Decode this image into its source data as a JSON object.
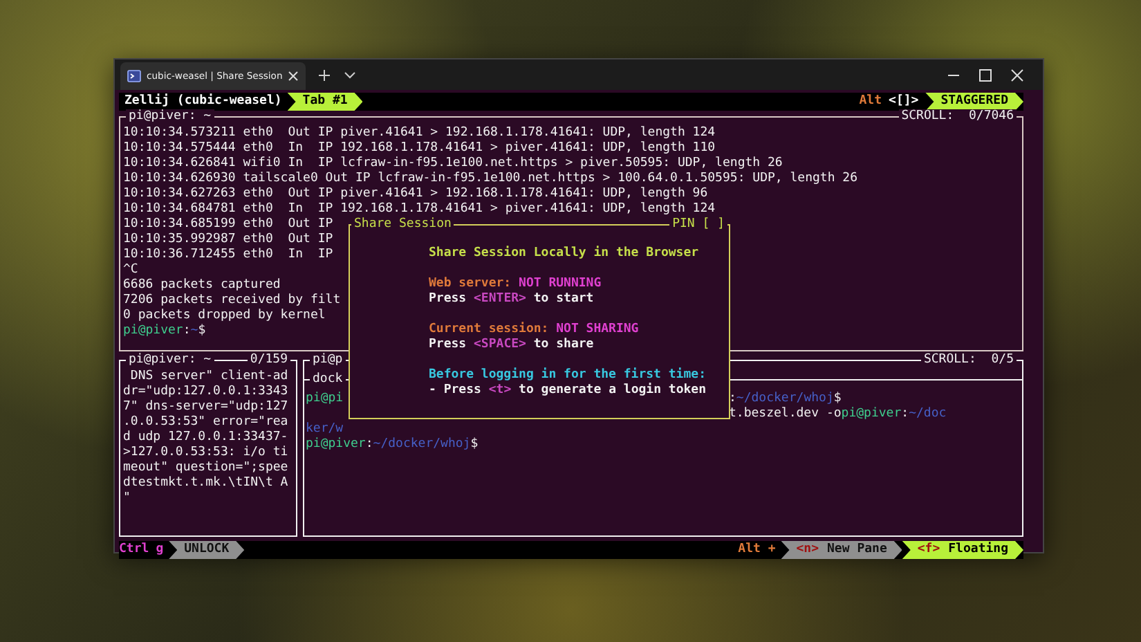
{
  "window": {
    "tab_title": "cubic-weasel | Share Session"
  },
  "top_bar": {
    "session": "Zellij (cubic-weasel)",
    "tabs": [
      {
        "label": "Tab #1",
        "selected": true
      }
    ],
    "modifier": "Alt",
    "key": "<[]>",
    "layout": "STAGGERED"
  },
  "top_pane": {
    "title": "pi@piver: ~",
    "scroll": "SCROLL:  0/7046",
    "lines": [
      {
        "segments": [
          {
            "text": "10:10:34.573211 eth0  Out IP piver.41641 > 192.168.1.178.41641: UDP, length 124",
            "kind": "plain"
          }
        ]
      },
      {
        "segments": [
          {
            "text": "10:10:34.575444 eth0  In  IP 192.168.1.178.41641 > piver.41641: UDP, length 110",
            "kind": "plain"
          }
        ]
      },
      {
        "segments": [
          {
            "text": "10:10:34.626841 wifi0 In  IP lcfraw-in-f95.1e100.net.https > piver.50595: UDP, length 26",
            "kind": "plain"
          }
        ]
      },
      {
        "segments": [
          {
            "text": "10:10:34.626930 tailscale0 Out IP lcfraw-in-f95.1e100.net.https > 100.64.0.1.50595: UDP, length 26",
            "kind": "plain"
          }
        ]
      },
      {
        "segments": [
          {
            "text": "10:10:34.627263 eth0  Out IP piver.41641 > 192.168.1.178.41641: UDP, length 96",
            "kind": "plain"
          }
        ]
      },
      {
        "segments": [
          {
            "text": "10:10:34.684781 eth0  In  IP 192.168.1.178.41641 > piver.41641: UDP, length 124",
            "kind": "plain"
          }
        ]
      },
      {
        "segments": [
          {
            "text": "10:10:34.685199 eth0  Out IP",
            "kind": "plain"
          }
        ]
      },
      {
        "segments": [
          {
            "text": "10:10:35.992987 eth0  Out IP",
            "kind": "plain"
          }
        ]
      },
      {
        "segments": [
          {
            "text": "10:10:36.712455 eth0  In  IP",
            "kind": "plain"
          }
        ]
      },
      {
        "segments": [
          {
            "text": "^C",
            "kind": "plain"
          }
        ]
      },
      {
        "segments": [
          {
            "text": "6686 packets captured",
            "kind": "plain"
          }
        ]
      },
      {
        "segments": [
          {
            "text": "7206 packets received by filt",
            "kind": "plain"
          }
        ]
      },
      {
        "segments": [
          {
            "text": "0 packets dropped by kernel",
            "kind": "plain"
          }
        ]
      },
      {
        "segments": [
          {
            "text": "pi@piver",
            "kind": "user"
          },
          {
            "text": ":",
            "kind": "plain"
          },
          {
            "text": "~",
            "kind": "path"
          },
          {
            "text": "$",
            "kind": "plain"
          }
        ]
      }
    ]
  },
  "bottom_left_pane": {
    "title": "pi@piver: ~",
    "position": "0/159",
    "lines": [
      " DNS server\" client-ad",
      "dr=\"udp:127.0.0.1:3343",
      "7\" dns-server=\"udp:127",
      ".0.0.53:53\" error=\"rea",
      "d udp 127.0.0.1:33437-",
      ">127.0.0.53:53: i/o ti",
      "meout\" question=\";spee",
      "dtestmkt.t.mk.\\tIN\\t A",
      "\""
    ]
  },
  "bottom_right": {
    "stacked_pane": {
      "title": "pi@p",
      "scroll": "SCROLL:  0/5"
    },
    "pane": {
      "title": "dock",
      "rows": [
        {
          "left": [
            {
              "text": "pi@pi",
              "kind": "user"
            }
          ],
          "right": [
            {
              "text": ":",
              "kind": "plain"
            },
            {
              "text": "~/docker/whoj",
              "kind": "path"
            },
            {
              "text": "$",
              "kind": "plain"
            }
          ]
        },
        {
          "right": [
            {
              "text": "t.beszel.dev -o",
              "kind": "plain"
            },
            {
              "text": "pi@piver",
              "kind": "user"
            },
            {
              "text": ":",
              "kind": "plain"
            },
            {
              "text": "~/doc",
              "kind": "path"
            }
          ]
        },
        {
          "left": [
            {
              "text": "ker/w",
              "kind": "path"
            }
          ]
        },
        {
          "left": [
            {
              "text": "pi@piver",
              "kind": "user"
            },
            {
              "text": ":",
              "kind": "plain"
            },
            {
              "text": "~/docker/whoj",
              "kind": "path"
            },
            {
              "text": "$",
              "kind": "plain"
            }
          ]
        }
      ]
    }
  },
  "popup": {
    "title": "Share Session",
    "pin": "PIN [ ]",
    "sections": [
      {
        "lines": [
          {
            "segments": [
              {
                "text": "Share Session Locally in the Browser",
                "kind": "heading"
              }
            ]
          }
        ]
      },
      {
        "lines": [
          {
            "segments": [
              {
                "text": "Web server: ",
                "kind": "label"
              },
              {
                "text": "NOT RUNNING",
                "kind": "status"
              }
            ]
          },
          {
            "segments": [
              {
                "text": "Press ",
                "kind": "plain"
              },
              {
                "text": "<ENTER>",
                "kind": "key"
              },
              {
                "text": " to start",
                "kind": "plain"
              }
            ]
          }
        ]
      },
      {
        "lines": [
          {
            "segments": [
              {
                "text": "Current session: ",
                "kind": "label"
              },
              {
                "text": "NOT SHARING",
                "kind": "status"
              }
            ]
          },
          {
            "segments": [
              {
                "text": "Press ",
                "kind": "plain"
              },
              {
                "text": "<SPACE>",
                "kind": "key"
              },
              {
                "text": " to share",
                "kind": "plain"
              }
            ]
          }
        ]
      },
      {
        "lines": [
          {
            "segments": [
              {
                "text": "Before logging in for the first time:",
                "kind": "note"
              }
            ]
          },
          {
            "segments": [
              {
                "text": "- Press ",
                "kind": "plain"
              },
              {
                "text": "<t>",
                "kind": "key"
              },
              {
                "text": " to generate a login token",
                "kind": "plain"
              }
            ]
          }
        ]
      }
    ]
  },
  "bottom_bar": {
    "modifier": "Ctrl",
    "key": "g",
    "lock": {
      "label": "UNLOCK",
      "selected": false
    },
    "alt": "Alt +",
    "hints": [
      {
        "key": "<n>",
        "label": "New Pane",
        "selected": false
      },
      {
        "key": "<f>",
        "label": "Floating",
        "selected": true
      }
    ]
  }
}
